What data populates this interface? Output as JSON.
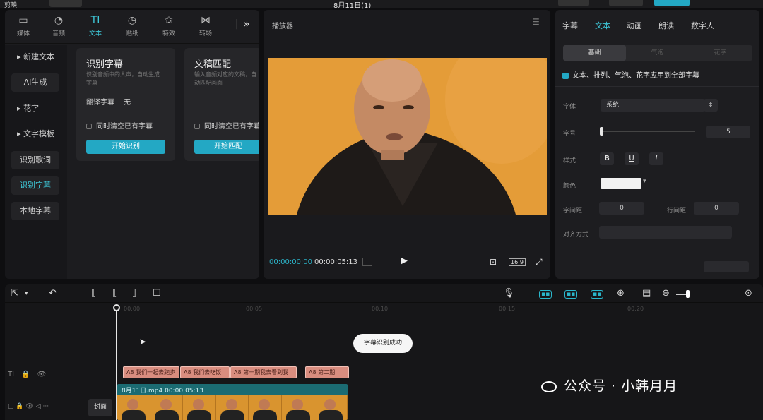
{
  "topbar": {
    "app": "剪映",
    "project": "8月11日(1)"
  },
  "left_tabs": [
    {
      "label": "媒体",
      "icon": "media-icon"
    },
    {
      "label": "音频",
      "icon": "audio-icon"
    },
    {
      "label": "文本",
      "icon": "text-icon",
      "active": true
    },
    {
      "label": "贴纸",
      "icon": "sticker-icon"
    },
    {
      "label": "特效",
      "icon": "effects-icon"
    },
    {
      "label": "转场",
      "icon": "transition-icon"
    }
  ],
  "side_items": [
    {
      "label": "▸ 新建文本"
    },
    {
      "label": "AI生成",
      "sub": true
    },
    {
      "label": "▸ 花字"
    },
    {
      "label": "▸ 文字模板"
    },
    {
      "label": "识别歌词",
      "sub": true
    },
    {
      "label": "识别字幕",
      "sub": true,
      "active": true
    },
    {
      "label": "本地字幕",
      "sub": true
    }
  ],
  "cards": [
    {
      "title": "识别字幕",
      "desc": "识别音频中的人声，自动生成字幕",
      "row1": "翻译字幕 　无",
      "row2": "同时清空已有字幕",
      "button": "开始识别"
    },
    {
      "title": "文稿匹配",
      "desc": "输入音频对应的文稿，自动匹配画面",
      "row1": "",
      "row2": "同时清空已有字幕",
      "button": "开始匹配"
    }
  ],
  "player": {
    "title": "播放器",
    "current": "00:00:00:00",
    "total": "00:00:05:13",
    "ratio": "16:9"
  },
  "right": {
    "tabs": [
      "字幕",
      "文本",
      "动画",
      "朗读",
      "数字人"
    ],
    "segments": [
      "基础",
      "气泡",
      "花字"
    ],
    "apply_all": "文本、排列、气泡、花字应用到全部字幕",
    "font_label": "字体",
    "font_value": "系统",
    "size_label": "字号",
    "size_value": "5",
    "style_label": "样式",
    "style_buttons": [
      "B",
      "U",
      "I"
    ],
    "color_label": "颜色",
    "color_value": "#f2f2f2",
    "letter_label": "字间距",
    "letter_value": "0",
    "line_label": "行间距",
    "line_value": "0",
    "align_label": "对齐方式"
  },
  "timeline": {
    "ticks": [
      "00:00",
      "00:05",
      "00:10",
      "00:15",
      "00:20"
    ],
    "tooltip": "字幕识别成功",
    "text_clips": [
      "A8 我们一起去跑步",
      "A8 我们去吃饭",
      "A8 第一期我去看到我",
      "A8 第二期"
    ],
    "video_clip": "8月11日.mp4  00:00:05:13",
    "cover_label": "封面"
  },
  "watermark": "公众号 · 小韩月月"
}
